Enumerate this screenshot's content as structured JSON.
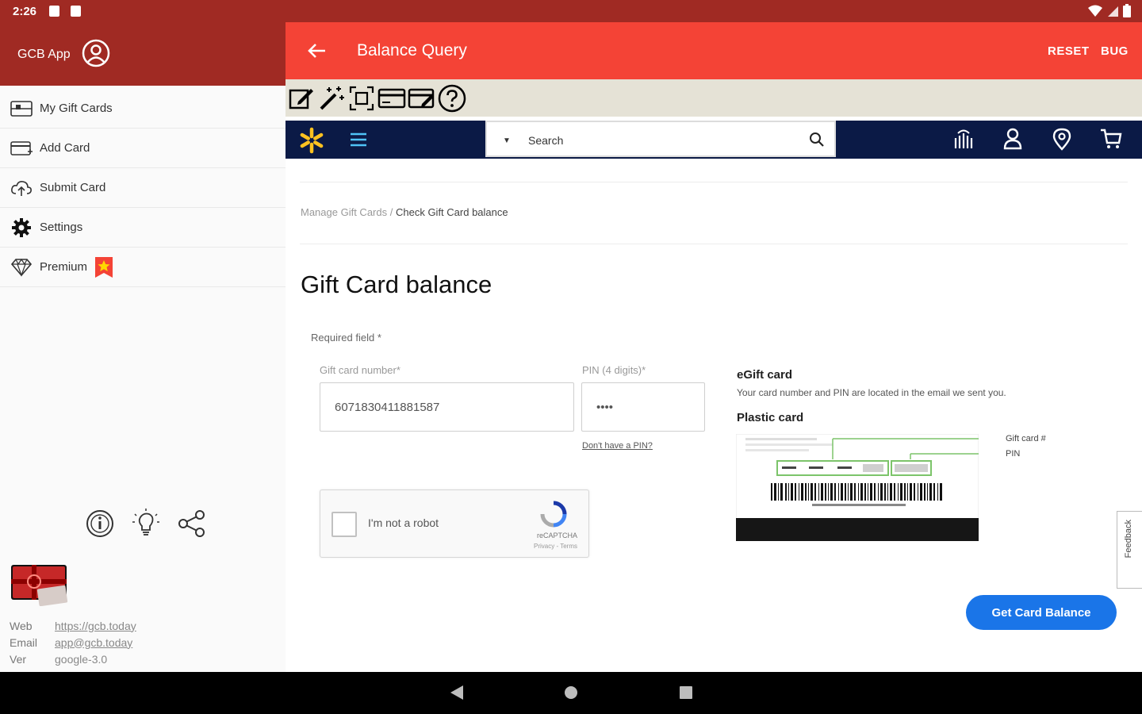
{
  "status_bar": {
    "time": "2:26"
  },
  "drawer": {
    "app_name": "GCB App",
    "menu": [
      {
        "label": "My Gift Cards",
        "icon": "gift-card-icon"
      },
      {
        "label": "Add Card",
        "icon": "add-card-icon"
      },
      {
        "label": "Submit Card",
        "icon": "cloud-upload-icon"
      },
      {
        "label": "Settings",
        "icon": "gear-icon"
      },
      {
        "label": "Premium",
        "icon": "diamond-icon"
      }
    ],
    "info": {
      "web_label": "Web",
      "web_value": "https://gcb.today",
      "email_label": "Email",
      "email_value": "app@gcb.today",
      "ver_label": "Ver",
      "ver_value": "google-3.0"
    }
  },
  "app_bar": {
    "title": "Balance Query",
    "reset_label": "RESET",
    "bug_label": "BUG"
  },
  "site": {
    "search_placeholder": "Search",
    "breadcrumb_parent": "Manage Gift Cards",
    "breadcrumb_separator": "/",
    "breadcrumb_current": "Check Gift Card balance",
    "page_title": "Gift Card balance",
    "required_note": "Required field *",
    "card_number_label": "Gift card number*",
    "card_number_value": "6071830411881587",
    "pin_label": "PIN (4 digits)*",
    "pin_value": "••••",
    "no_pin_link": "Don't have a PIN?",
    "captcha_text": "I'm not a robot",
    "captcha_brand": "reCAPTCHA",
    "captcha_privacy": "Privacy - Terms",
    "egift_title": "eGift card",
    "egift_desc": "Your card number and PIN are located in the email we sent you.",
    "plastic_title": "Plastic card",
    "card_label_number": "Gift card #",
    "card_label_pin": "PIN",
    "feedback_label": "Feedback",
    "balance_button": "Get Card Balance"
  },
  "colors": {
    "status_bar": "#a02a23",
    "app_bar": "#f44336",
    "site_header": "#0b1a46",
    "spark": "#ffc220",
    "button": "#1a75e8"
  }
}
